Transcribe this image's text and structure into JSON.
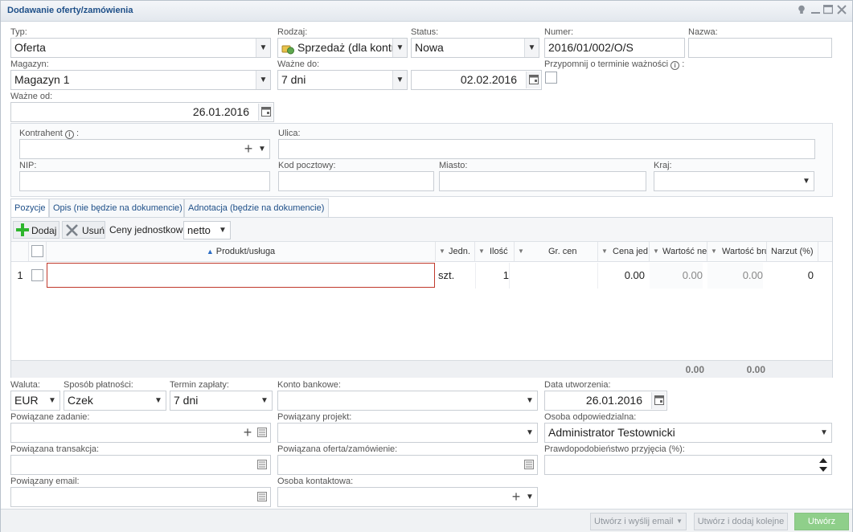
{
  "window": {
    "title": "Dodawanie oferty/zamówienia"
  },
  "header": {
    "typ": {
      "label": "Typ:",
      "value": "Oferta"
    },
    "rodzaj": {
      "label": "Rodzaj:",
      "value": "Sprzedaż (dla kontra"
    },
    "status": {
      "label": "Status:",
      "value": "Nowa"
    },
    "numer": {
      "label": "Numer:",
      "value": "2016/01/002/O/S"
    },
    "nazwa": {
      "label": "Nazwa:",
      "value": ""
    },
    "magazyn": {
      "label": "Magazyn:",
      "value": "Magazyn 1"
    },
    "wazne_do": {
      "label": "Ważne do:",
      "value": "7 dni",
      "date": "02.02.2016"
    },
    "przypomnij": {
      "label": "Przypomnij o terminie ważności",
      "suffix": ":"
    },
    "wazne_od": {
      "label": "Ważne od:",
      "date": "26.01.2016"
    }
  },
  "kontrahent": {
    "kontrahent": {
      "label": "Kontrahent",
      "suffix": ":"
    },
    "ulica": {
      "label": "Ulica:"
    },
    "nip": {
      "label": "NIP:"
    },
    "kod": {
      "label": "Kod pocztowy:"
    },
    "miasto": {
      "label": "Miasto:"
    },
    "kraj": {
      "label": "Kraj:"
    }
  },
  "tabs": [
    {
      "label": "Pozycje"
    },
    {
      "label": "Opis (nie będzie na dokumencie)"
    },
    {
      "label": "Adnotacja (będzie na dokumencie)"
    }
  ],
  "toolbar": {
    "add": "Dodaj",
    "remove": "Usuń",
    "prices_label": "Ceny jednostkowe",
    "prices_value": "netto"
  },
  "grid": {
    "columns": [
      "Produkt/usługa",
      "Jedn.",
      "Ilość",
      "Gr. cen",
      "Cena jed",
      "Wartość ne",
      "Wartość bru",
      "Narzut (%)"
    ],
    "rows": [
      {
        "lp": "1",
        "produkt": "",
        "jedn": "szt.",
        "ilosc": "1",
        "gr_cen": "",
        "cena": "0.00",
        "netto": "0.00",
        "brutto": "0.00",
        "narzut": "0"
      }
    ],
    "totals": {
      "netto": "0.00",
      "brutto": "0.00"
    }
  },
  "bottom": {
    "waluta": {
      "label": "Waluta:",
      "value": "EUR"
    },
    "platnosc": {
      "label": "Sposób płatności:",
      "value": "Czek"
    },
    "termin": {
      "label": "Termin zapłaty:",
      "value": "7 dni"
    },
    "konto": {
      "label": "Konto bankowe:",
      "value": ""
    },
    "data_utw": {
      "label": "Data utworzenia:",
      "value": "26.01.2016"
    },
    "zadanie": {
      "label": "Powiązane zadanie:"
    },
    "projekt": {
      "label": "Powiązany projekt:"
    },
    "osoba": {
      "label": "Osoba odpowiedzialna:",
      "value": "Administrator Testownicki"
    },
    "transakcja": {
      "label": "Powiązana transakcja:"
    },
    "oferta": {
      "label": "Powiązana oferta/zamówienie:"
    },
    "prawdop": {
      "label": "Prawdopodobieństwo przyjęcia (%):"
    },
    "email": {
      "label": "Powiązany email:"
    },
    "kontakt": {
      "label": "Osoba kontaktowa:"
    }
  },
  "footer": {
    "btn_email": "Utwórz i wyślij email",
    "btn_next": "Utwórz i dodaj kolejne",
    "btn_create": "Utwórz"
  },
  "colors": {
    "accent": "#1e4f88",
    "add_green": "#2db52d",
    "error_border": "#c0392b",
    "primary_btn": "#8fcf8a"
  },
  "icons": [
    "info-icon",
    "calendar-icon",
    "dropdown-icon",
    "plus-icon",
    "remove-x-icon",
    "spinner-icon",
    "lightbulb-icon",
    "minimize-icon",
    "maximize-icon",
    "close-icon",
    "sort-asc-icon",
    "deal-icon"
  ]
}
